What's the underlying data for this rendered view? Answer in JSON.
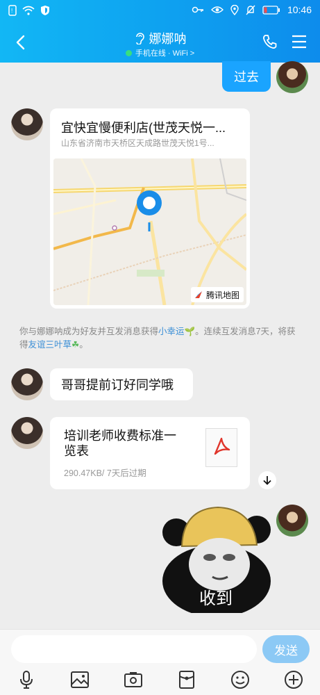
{
  "status_bar": {
    "time": "10:46"
  },
  "header": {
    "title": "娜娜呐",
    "subtitle": "手机在线 · WiFi >",
    "icons": [
      "back-icon",
      "ear-icon",
      "phone-icon",
      "menu-icon"
    ]
  },
  "messages": {
    "m1_text": "过去",
    "location": {
      "title": "宜快宜慢便利店(世茂天悦一...",
      "address": "山东省济南市天桥区天成路世茂天悦1号...",
      "map_brand": "腾讯地图"
    },
    "system_note": {
      "part1": "你与娜娜呐成为好友并互发消息获得",
      "link1": "小幸运",
      "part2": "。连续互发消息7天，将获得",
      "link2": "友谊三叶草",
      "part3": "。"
    },
    "m3_text": "哥哥提前订好同学哦",
    "file": {
      "name": "培训老师收费标准一览表",
      "meta": "290.47KB/ 7天后过期"
    },
    "sticker_text": "收到"
  },
  "input": {
    "placeholder": "",
    "send_label": "发送"
  },
  "toolbar_icons": [
    "microphone-icon",
    "image-icon",
    "camera-icon",
    "red-packet-icon",
    "emoji-icon",
    "plus-icon"
  ],
  "colors": {
    "header": "#12b7f5",
    "bubble_me": "#1aa4ff",
    "send_disabled": "#8cc9f5",
    "link": "#3b8fd6"
  }
}
